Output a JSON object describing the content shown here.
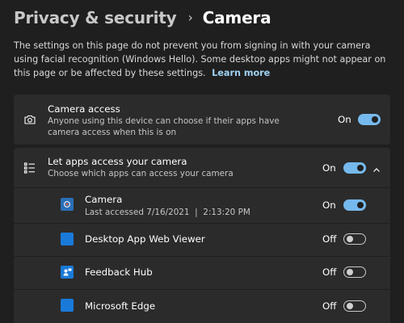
{
  "breadcrumb": {
    "parent": "Privacy & security",
    "separator": "›",
    "current": "Camera"
  },
  "description": {
    "text": "The settings on this page do not prevent you from signing in with your camera using facial recognition (Windows Hello). Some desktop apps might not appear on this page or be affected by these settings.",
    "link": "Learn more"
  },
  "camera_access": {
    "icon": "camera-icon",
    "title": "Camera access",
    "subtitle": "Anyone using this device can choose if their apps have camera access when this is on",
    "state": "On",
    "enabled": true
  },
  "apps_access": {
    "icon": "list-icon",
    "title": "Let apps access your camera",
    "subtitle": "Choose which apps can access your camera",
    "state": "On",
    "enabled": true,
    "expanded": true
  },
  "apps": [
    {
      "name": "Camera",
      "subtitle": "Last accessed 7/16/2021  |  2:13:20 PM",
      "state": "On",
      "enabled": true,
      "icon": "camera-app-icon"
    },
    {
      "name": "Desktop App Web Viewer",
      "state": "Off",
      "enabled": false,
      "icon": "web-viewer-app-icon"
    },
    {
      "name": "Feedback Hub",
      "state": "Off",
      "enabled": false,
      "icon": "feedback-hub-app-icon"
    },
    {
      "name": "Microsoft Edge",
      "state": "Off",
      "enabled": false,
      "icon": "edge-app-icon"
    }
  ],
  "colors": {
    "background": "#1f1f1f",
    "card": "#2b2b2b",
    "accent": "#76b9ed",
    "link": "#9fd2f2"
  }
}
